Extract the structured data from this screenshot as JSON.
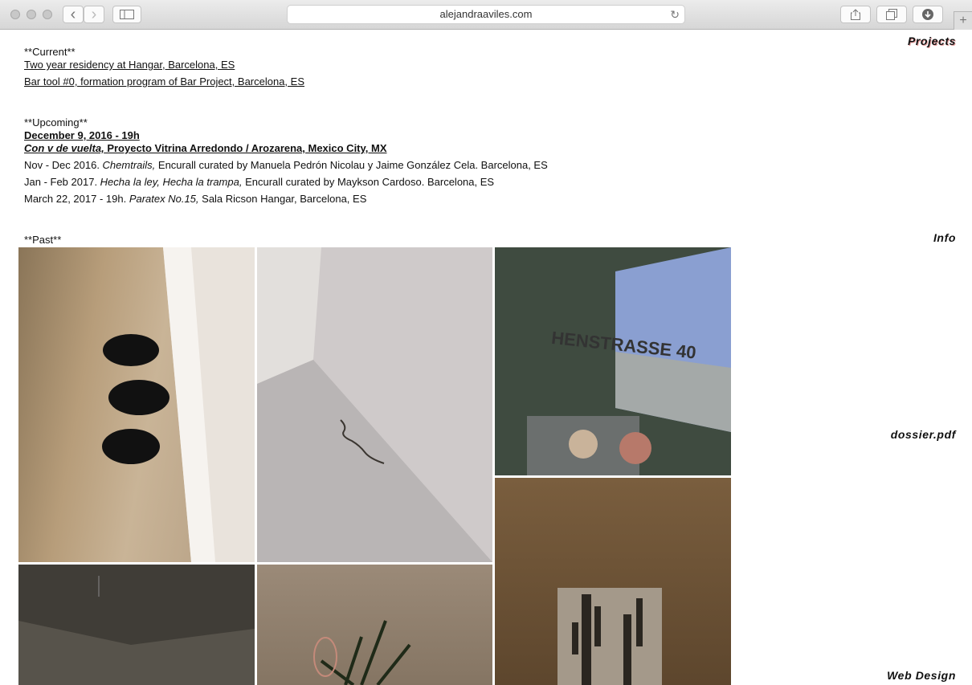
{
  "browser": {
    "url": "alejandraaviles.com",
    "back_icon": "‹",
    "forward_icon": "›",
    "reload_icon": "↻",
    "new_tab_icon": "+"
  },
  "sidenav": {
    "projects": "Projects",
    "info": "Info",
    "dossier": "dossier.pdf",
    "webdesign": "Web Design"
  },
  "current": {
    "heading": "**Current**",
    "items": [
      "Two year residency at Hangar, Barcelona, ES",
      "Bar tool #0, formation program of Bar Project, Barcelona, ES"
    ]
  },
  "upcoming": {
    "heading": "**Upcoming**",
    "featured_date": "December 9, 2016 - 19h",
    "featured_title": "Con v de vuelta,",
    "featured_rest": " Proyecto Vitrina Arredondo / Arozarena, Mexico City, MX",
    "items": [
      {
        "pre": "Nov - Dec 2016. ",
        "title": "Chemtrails,",
        "rest": " Encurall curated by Manuela Pedrón Nicolau y Jaime González Cela. Barcelona, ES"
      },
      {
        "pre": "Jan - Feb 2017. ",
        "title": "Hecha la ley, Hecha la trampa,",
        "rest": " Encurall curated by Maykson Cardoso. Barcelona, ES"
      },
      {
        "pre": "March 22, 2017 - 19h. ",
        "title": "Paratex No.15,",
        "rest": " Sala Ricson Hangar, Barcelona, ES"
      }
    ]
  },
  "past": {
    "heading": "**Past**",
    "photo_sign_text": "HENSTRASSE 40"
  }
}
